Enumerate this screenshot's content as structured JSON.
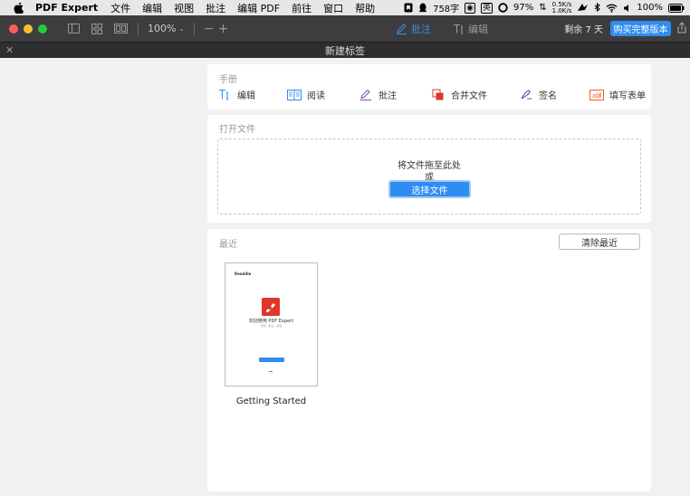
{
  "menubar": {
    "app_name": "PDF Expert",
    "items": [
      "文件",
      "编辑",
      "视图",
      "批注",
      "编辑 PDF",
      "前往",
      "窗口",
      "帮助"
    ],
    "word_count": "758字",
    "ime_label": "英",
    "battery_small": "97%",
    "net_up": "0.5K/s",
    "net_down": "1.0K/s",
    "battery": "100%"
  },
  "toolbar": {
    "zoom": "100%",
    "mode_annotate": "批注",
    "mode_edit": "编辑",
    "trial_text": "剩余 7 天",
    "buy_label": "购买完整版本"
  },
  "tab": {
    "title": "新建标签"
  },
  "handbook": {
    "title": "手册",
    "items": [
      {
        "label": "编辑",
        "icon": "text-edit-icon",
        "color": "#2f8cf0"
      },
      {
        "label": "阅读",
        "icon": "book-icon",
        "color": "#2f8cf0"
      },
      {
        "label": "批注",
        "icon": "pen-icon",
        "color": "#8a4ccf"
      },
      {
        "label": "合并文件",
        "icon": "merge-icon",
        "color": "#e0352b"
      },
      {
        "label": "签名",
        "icon": "signature-icon",
        "color": "#6b3fb0"
      },
      {
        "label": "填写表单",
        "icon": "form-icon",
        "color": "#e8632b"
      }
    ]
  },
  "open_file": {
    "title": "打开文件",
    "drop_text": "将文件拖至此处",
    "or_text": "或",
    "choose_label": "选择文件"
  },
  "recent": {
    "title": "最近",
    "clear_label": "清除最近",
    "files": [
      {
        "name": "Getting Started",
        "thumb_brand": "Readdle",
        "thumb_title": "欢迎使用 PDF Expert",
        "thumb_sub": "阅读 · 批注 · 编辑"
      }
    ]
  },
  "colors": {
    "accent": "#2f8cf0",
    "toolbar_bg": "#3d3d3f",
    "tabbar_bg": "#2e2e30"
  }
}
